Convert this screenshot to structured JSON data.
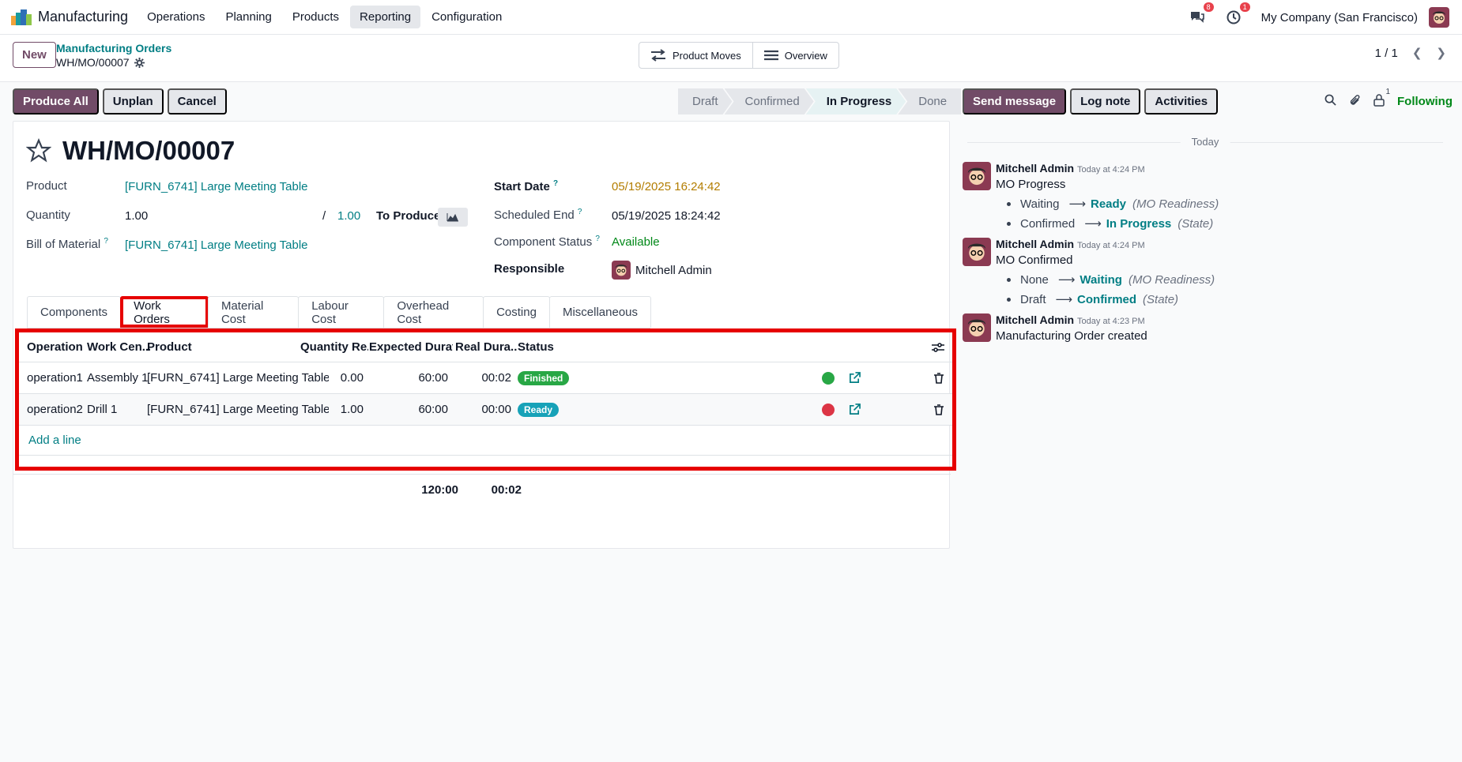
{
  "app": {
    "name": "Manufacturing"
  },
  "menu": [
    "Operations",
    "Planning",
    "Products",
    "Reporting",
    "Configuration"
  ],
  "nav": {
    "messages_badge": "8",
    "activities_badge": "1",
    "company": "My Company (San Francisco)"
  },
  "control": {
    "new_label": "New",
    "breadcrumb_parent": "Manufacturing Orders",
    "breadcrumb_current": "WH/MO/00007",
    "product_moves": "Product Moves",
    "overview": "Overview",
    "pager": "1 / 1"
  },
  "actions": [
    "Produce All",
    "Unplan",
    "Cancel"
  ],
  "stages": [
    "Draft",
    "Confirmed",
    "In Progress",
    "Done"
  ],
  "record": {
    "title": "WH/MO/00007",
    "product_label": "Product",
    "product": "[FURN_6741] Large Meeting Table",
    "quantity_label": "Quantity",
    "quantity": "1.00",
    "qty_slash": "/",
    "qty_to_produce": "1.00",
    "to_produce_label": "To Produce",
    "bom_label": "Bill of Material",
    "bom": "[FURN_6741] Large Meeting Table",
    "start_label": "Start Date",
    "start": "05/19/2025 16:24:42",
    "end_label": "Scheduled End",
    "end": "05/19/2025 18:24:42",
    "comp_label": "Component Status",
    "comp": "Available",
    "resp_label": "Responsible",
    "resp": "Mitchell Admin",
    "help_mark": "?"
  },
  "tabs": [
    "Components",
    "Work Orders",
    "Material Cost",
    "Labour Cost",
    "Overhead Cost",
    "Costing",
    "Miscellaneous"
  ],
  "work_orders": {
    "headers": [
      "Operation",
      "Work Cen...",
      "Product",
      "Quantity Re...",
      "Expected Durat...",
      "Real Dura...",
      "Status"
    ],
    "rows": [
      {
        "operation": "operation1",
        "center": "Assembly 1",
        "product": "[FURN_6741] Large Meeting Table",
        "qty": "0.00",
        "expected": "60:00",
        "real": "00:02",
        "status": "Finished"
      },
      {
        "operation": "operation2",
        "center": "Drill 1",
        "product": "[FURN_6741] Large Meeting Table",
        "qty": "1.00",
        "expected": "60:00",
        "real": "00:00",
        "status": "Ready"
      }
    ],
    "add_line": "Add a line",
    "total_expected": "120:00",
    "total_real": "00:02"
  },
  "chatter": {
    "send_message": "Send message",
    "log_note": "Log note",
    "activities": "Activities",
    "follower_count": "1",
    "following": "Following",
    "today": "Today",
    "messages": [
      {
        "author": "Mitchell Admin",
        "time": "Today at 4:24 PM",
        "title": "MO Progress",
        "changes": [
          {
            "old": "Waiting",
            "new": "Ready",
            "field": "(MO Readiness)"
          },
          {
            "old": "Confirmed",
            "new": "In Progress",
            "field": "(State)"
          }
        ]
      },
      {
        "author": "Mitchell Admin",
        "time": "Today at 4:24 PM",
        "title": "MO Confirmed",
        "changes": [
          {
            "old": "None",
            "new": "Waiting",
            "field": "(MO Readiness)"
          },
          {
            "old": "Draft",
            "new": "Confirmed",
            "field": "(State)"
          }
        ]
      },
      {
        "author": "Mitchell Admin",
        "time": "Today at 4:23 PM",
        "title": "Manufacturing Order created",
        "changes": []
      }
    ]
  },
  "colors": {
    "primary": "#714b67",
    "link": "#017e84",
    "highlight": "#e60000",
    "finished": "#28a745",
    "ready": "#17a2b8"
  }
}
